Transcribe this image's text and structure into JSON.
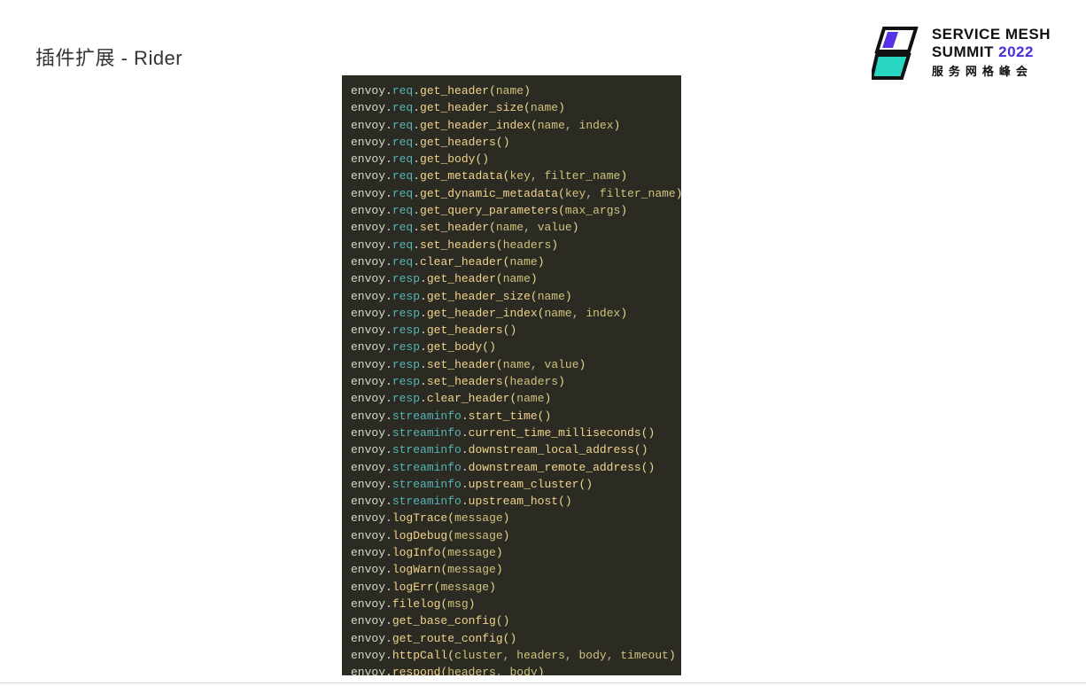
{
  "title": "插件扩展 - Rider",
  "logo": {
    "line1": "SERVICE MESH",
    "line2_a": "SUMMIT ",
    "line2_b": "2022",
    "sub": "服务网格峰会"
  },
  "code": [
    [
      [
        "id",
        "envoy"
      ],
      [
        "p",
        "."
      ],
      [
        "ns",
        "req"
      ],
      [
        "p",
        "."
      ],
      [
        "fn",
        "get_header"
      ],
      [
        "pr",
        "("
      ],
      [
        "a",
        "name"
      ],
      [
        "pr",
        ")"
      ]
    ],
    [
      [
        "id",
        "envoy"
      ],
      [
        "p",
        "."
      ],
      [
        "ns",
        "req"
      ],
      [
        "p",
        "."
      ],
      [
        "fn",
        "get_header_size"
      ],
      [
        "pr",
        "("
      ],
      [
        "a",
        "name"
      ],
      [
        "pr",
        ")"
      ]
    ],
    [
      [
        "id",
        "envoy"
      ],
      [
        "p",
        "."
      ],
      [
        "ns",
        "req"
      ],
      [
        "p",
        "."
      ],
      [
        "fn",
        "get_header_index"
      ],
      [
        "pr",
        "("
      ],
      [
        "a",
        "name"
      ],
      [
        "cm",
        ", "
      ],
      [
        "a",
        "index"
      ],
      [
        "pr",
        ")"
      ]
    ],
    [
      [
        "id",
        "envoy"
      ],
      [
        "p",
        "."
      ],
      [
        "ns",
        "req"
      ],
      [
        "p",
        "."
      ],
      [
        "fn",
        "get_headers"
      ],
      [
        "pr",
        "("
      ],
      [
        "pr",
        ")"
      ]
    ],
    [
      [
        "id",
        "envoy"
      ],
      [
        "p",
        "."
      ],
      [
        "ns",
        "req"
      ],
      [
        "p",
        "."
      ],
      [
        "fn",
        "get_body"
      ],
      [
        "pr",
        "("
      ],
      [
        "pr",
        ")"
      ]
    ],
    [
      [
        "id",
        "envoy"
      ],
      [
        "p",
        "."
      ],
      [
        "ns",
        "req"
      ],
      [
        "p",
        "."
      ],
      [
        "fn",
        "get_metadata"
      ],
      [
        "pr",
        "("
      ],
      [
        "a",
        "key"
      ],
      [
        "cm",
        ", "
      ],
      [
        "a",
        "filter_name"
      ],
      [
        "pr",
        ")"
      ]
    ],
    [
      [
        "id",
        "envoy"
      ],
      [
        "p",
        "."
      ],
      [
        "ns",
        "req"
      ],
      [
        "p",
        "."
      ],
      [
        "fn",
        "get_dynamic_metadata"
      ],
      [
        "pr",
        "("
      ],
      [
        "a",
        "key"
      ],
      [
        "cm",
        ", "
      ],
      [
        "a",
        "filter_name"
      ],
      [
        "pr",
        ")"
      ]
    ],
    [
      [
        "id",
        "envoy"
      ],
      [
        "p",
        "."
      ],
      [
        "ns",
        "req"
      ],
      [
        "p",
        "."
      ],
      [
        "fn",
        "get_query_parameters"
      ],
      [
        "pr",
        "("
      ],
      [
        "a",
        "max_args"
      ],
      [
        "pr",
        ")"
      ]
    ],
    [
      [
        "id",
        "envoy"
      ],
      [
        "p",
        "."
      ],
      [
        "ns",
        "req"
      ],
      [
        "p",
        "."
      ],
      [
        "fn",
        "set_header"
      ],
      [
        "pr",
        "("
      ],
      [
        "a",
        "name"
      ],
      [
        "cm",
        ", "
      ],
      [
        "a",
        "value"
      ],
      [
        "pr",
        ")"
      ]
    ],
    [
      [
        "id",
        "envoy"
      ],
      [
        "p",
        "."
      ],
      [
        "ns",
        "req"
      ],
      [
        "p",
        "."
      ],
      [
        "fn",
        "set_headers"
      ],
      [
        "pr",
        "("
      ],
      [
        "a",
        "headers"
      ],
      [
        "pr",
        ")"
      ]
    ],
    [
      [
        "id",
        "envoy"
      ],
      [
        "p",
        "."
      ],
      [
        "ns",
        "req"
      ],
      [
        "p",
        "."
      ],
      [
        "fn",
        "clear_header"
      ],
      [
        "pr",
        "("
      ],
      [
        "a",
        "name"
      ],
      [
        "pr",
        ")"
      ]
    ],
    [
      [
        "id",
        "envoy"
      ],
      [
        "p",
        "."
      ],
      [
        "ns",
        "resp"
      ],
      [
        "p",
        "."
      ],
      [
        "fn",
        "get_header"
      ],
      [
        "pr",
        "("
      ],
      [
        "a",
        "name"
      ],
      [
        "pr",
        ")"
      ]
    ],
    [
      [
        "id",
        "envoy"
      ],
      [
        "p",
        "."
      ],
      [
        "ns",
        "resp"
      ],
      [
        "p",
        "."
      ],
      [
        "fn",
        "get_header_size"
      ],
      [
        "pr",
        "("
      ],
      [
        "a",
        "name"
      ],
      [
        "pr",
        ")"
      ]
    ],
    [
      [
        "id",
        "envoy"
      ],
      [
        "p",
        "."
      ],
      [
        "ns",
        "resp"
      ],
      [
        "p",
        "."
      ],
      [
        "fn",
        "get_header_index"
      ],
      [
        "pr",
        "("
      ],
      [
        "a",
        "name"
      ],
      [
        "cm",
        ", "
      ],
      [
        "a",
        "index"
      ],
      [
        "pr",
        ")"
      ]
    ],
    [
      [
        "id",
        "envoy"
      ],
      [
        "p",
        "."
      ],
      [
        "ns",
        "resp"
      ],
      [
        "p",
        "."
      ],
      [
        "fn",
        "get_headers"
      ],
      [
        "pr",
        "("
      ],
      [
        "pr",
        ")"
      ]
    ],
    [
      [
        "id",
        "envoy"
      ],
      [
        "p",
        "."
      ],
      [
        "ns",
        "resp"
      ],
      [
        "p",
        "."
      ],
      [
        "fn",
        "get_body"
      ],
      [
        "pr",
        "("
      ],
      [
        "pr",
        ")"
      ]
    ],
    [
      [
        "id",
        "envoy"
      ],
      [
        "p",
        "."
      ],
      [
        "ns",
        "resp"
      ],
      [
        "p",
        "."
      ],
      [
        "fn",
        "set_header"
      ],
      [
        "pr",
        "("
      ],
      [
        "a",
        "name"
      ],
      [
        "cm",
        ", "
      ],
      [
        "a",
        "value"
      ],
      [
        "pr",
        ")"
      ]
    ],
    [
      [
        "id",
        "envoy"
      ],
      [
        "p",
        "."
      ],
      [
        "ns",
        "resp"
      ],
      [
        "p",
        "."
      ],
      [
        "fn",
        "set_headers"
      ],
      [
        "pr",
        "("
      ],
      [
        "a",
        "headers"
      ],
      [
        "pr",
        ")"
      ]
    ],
    [
      [
        "id",
        "envoy"
      ],
      [
        "p",
        "."
      ],
      [
        "ns",
        "resp"
      ],
      [
        "p",
        "."
      ],
      [
        "fn",
        "clear_header"
      ],
      [
        "pr",
        "("
      ],
      [
        "a",
        "name"
      ],
      [
        "pr",
        ")"
      ]
    ],
    [
      [
        "id",
        "envoy"
      ],
      [
        "p",
        "."
      ],
      [
        "ns",
        "streaminfo"
      ],
      [
        "p",
        "."
      ],
      [
        "fn",
        "start_time"
      ],
      [
        "pr",
        "("
      ],
      [
        "pr",
        ")"
      ]
    ],
    [
      [
        "id",
        "envoy"
      ],
      [
        "p",
        "."
      ],
      [
        "ns",
        "streaminfo"
      ],
      [
        "p",
        "."
      ],
      [
        "fn",
        "current_time_milliseconds"
      ],
      [
        "pr",
        "("
      ],
      [
        "pr",
        ")"
      ]
    ],
    [
      [
        "id",
        "envoy"
      ],
      [
        "p",
        "."
      ],
      [
        "ns",
        "streaminfo"
      ],
      [
        "p",
        "."
      ],
      [
        "fn",
        "downstream_local_address"
      ],
      [
        "pr",
        "("
      ],
      [
        "pr",
        ")"
      ]
    ],
    [
      [
        "id",
        "envoy"
      ],
      [
        "p",
        "."
      ],
      [
        "ns",
        "streaminfo"
      ],
      [
        "p",
        "."
      ],
      [
        "fn",
        "downstream_remote_address"
      ],
      [
        "pr",
        "("
      ],
      [
        "pr",
        ")"
      ]
    ],
    [
      [
        "id",
        "envoy"
      ],
      [
        "p",
        "."
      ],
      [
        "ns",
        "streaminfo"
      ],
      [
        "p",
        "."
      ],
      [
        "fn",
        "upstream_cluster"
      ],
      [
        "pr",
        "("
      ],
      [
        "pr",
        ")"
      ]
    ],
    [
      [
        "id",
        "envoy"
      ],
      [
        "p",
        "."
      ],
      [
        "ns",
        "streaminfo"
      ],
      [
        "p",
        "."
      ],
      [
        "fn",
        "upstream_host"
      ],
      [
        "pr",
        "("
      ],
      [
        "pr",
        ")"
      ]
    ],
    [
      [
        "id",
        "envoy"
      ],
      [
        "p",
        "."
      ],
      [
        "fn",
        "logTrace"
      ],
      [
        "pr",
        "("
      ],
      [
        "a",
        "message"
      ],
      [
        "pr",
        ")"
      ]
    ],
    [
      [
        "id",
        "envoy"
      ],
      [
        "p",
        "."
      ],
      [
        "fn",
        "logDebug"
      ],
      [
        "pr",
        "("
      ],
      [
        "a",
        "message"
      ],
      [
        "pr",
        ")"
      ]
    ],
    [
      [
        "id",
        "envoy"
      ],
      [
        "p",
        "."
      ],
      [
        "fn",
        "logInfo"
      ],
      [
        "pr",
        "("
      ],
      [
        "a",
        "message"
      ],
      [
        "pr",
        ")"
      ]
    ],
    [
      [
        "id",
        "envoy"
      ],
      [
        "p",
        "."
      ],
      [
        "fn",
        "logWarn"
      ],
      [
        "pr",
        "("
      ],
      [
        "a",
        "message"
      ],
      [
        "pr",
        ")"
      ]
    ],
    [
      [
        "id",
        "envoy"
      ],
      [
        "p",
        "."
      ],
      [
        "fn",
        "logErr"
      ],
      [
        "pr",
        "("
      ],
      [
        "a",
        "message"
      ],
      [
        "pr",
        ")"
      ]
    ],
    [
      [
        "id",
        "envoy"
      ],
      [
        "p",
        "."
      ],
      [
        "fn",
        "filelog"
      ],
      [
        "pr",
        "("
      ],
      [
        "a",
        "msg"
      ],
      [
        "pr",
        ")"
      ]
    ],
    [
      [
        "id",
        "envoy"
      ],
      [
        "p",
        "."
      ],
      [
        "fn",
        "get_base_config"
      ],
      [
        "pr",
        "("
      ],
      [
        "pr",
        ")"
      ]
    ],
    [
      [
        "id",
        "envoy"
      ],
      [
        "p",
        "."
      ],
      [
        "fn",
        "get_route_config"
      ],
      [
        "pr",
        "("
      ],
      [
        "pr",
        ")"
      ]
    ],
    [
      [
        "id",
        "envoy"
      ],
      [
        "p",
        "."
      ],
      [
        "fn",
        "httpCall"
      ],
      [
        "pr",
        "("
      ],
      [
        "a",
        "cluster"
      ],
      [
        "cm",
        ", "
      ],
      [
        "a",
        "headers"
      ],
      [
        "cm",
        ", "
      ],
      [
        "a",
        "body"
      ],
      [
        "cm",
        ", "
      ],
      [
        "a",
        "timeout"
      ],
      [
        "pr",
        ")"
      ]
    ],
    [
      [
        "id",
        "envoy"
      ],
      [
        "p",
        "."
      ],
      [
        "fn",
        "respond"
      ],
      [
        "pr",
        "("
      ],
      [
        "a",
        "headers"
      ],
      [
        "cm",
        ", "
      ],
      [
        "a",
        "body"
      ],
      [
        "pr",
        ")"
      ]
    ]
  ]
}
